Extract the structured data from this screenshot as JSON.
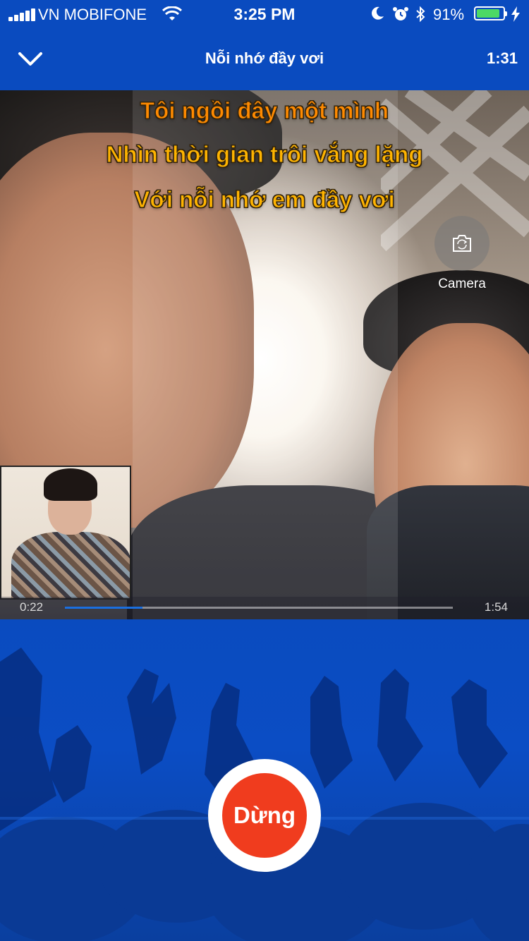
{
  "status_bar": {
    "carrier": "VN MOBIFONE",
    "time": "3:25 PM",
    "battery_percent": "91%",
    "battery_level": 0.91,
    "icons": [
      "signal-icon",
      "wifi-icon",
      "moon-icon",
      "alarm-icon",
      "bluetooth-icon",
      "battery-icon",
      "charging-icon"
    ]
  },
  "nav": {
    "title": "Nỗi nhớ đầy vơi",
    "remaining": "1:31",
    "back_icon": "chevron-down-icon"
  },
  "lyrics": {
    "lines": [
      "Tôi ngồi đây một mình",
      "Nhìn thời gian trôi vắng lặng",
      "Với nỗi nhớ em đầy vơi"
    ]
  },
  "camera": {
    "label": "Camera",
    "icon": "camera-flip-icon"
  },
  "playback": {
    "current": "0:22",
    "total": "1:54",
    "progress": 0.2
  },
  "controls": {
    "stop_label": "Dừng"
  },
  "colors": {
    "brand_blue": "#0a4bbf",
    "lyric_yellow": "#ffb400",
    "lyric_orange": "#ff8a00",
    "stop_red": "#f03c1e",
    "progress_blue": "#1a6fe0",
    "battery_green": "#4cd964"
  }
}
